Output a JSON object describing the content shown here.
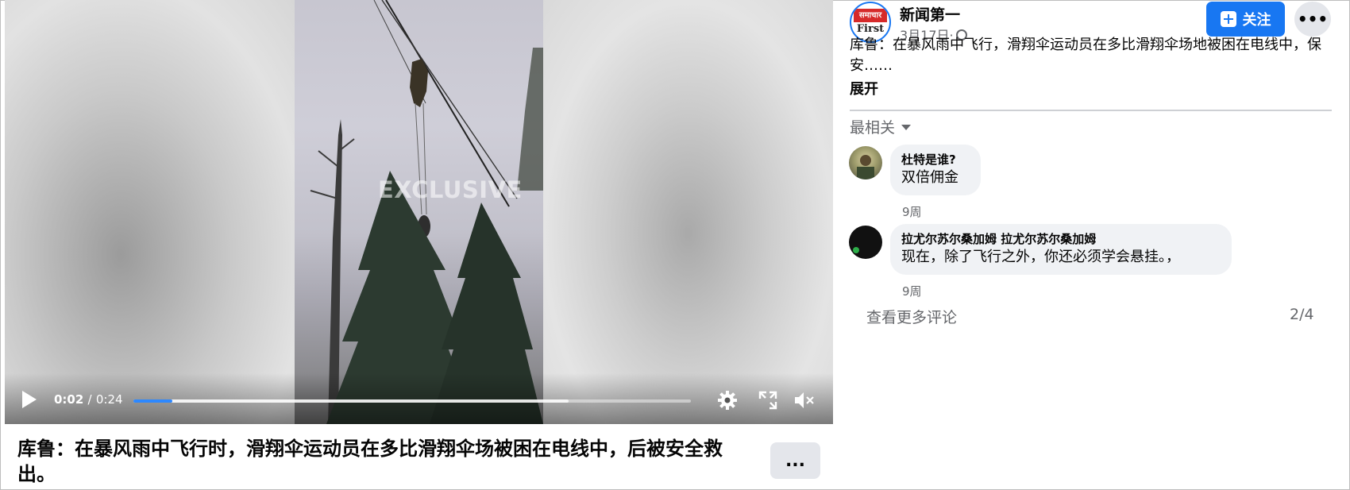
{
  "video": {
    "watermark": "EXCLUSIVE",
    "current_time": "0:02",
    "separator": "/",
    "duration": "0:24",
    "progress_fraction": 0.07,
    "buffered_fraction": 0.78,
    "accent": "#2d88ff",
    "icons": [
      "play-icon",
      "settings-gear-icon",
      "fullscreen-icon",
      "volume-muted-icon"
    ]
  },
  "caption": {
    "text": "库鲁：在暴风雨中飞行时，滑翔伞运动员在多比滑翔伞场被困在电线中，后被安全救出。",
    "more_label": "..."
  },
  "post": {
    "avatar_top": "समाचार",
    "avatar_bottom": "First",
    "page_name": "新闻第一",
    "date": "3月17日·",
    "follow_label": "关注",
    "more_label": "•••",
    "text": "库鲁：在暴风雨中飞行，滑翔伞运动员在多比滑翔伞场地被困在电线中，保安……",
    "expand_label": "展开",
    "brand_color": "#1877f2"
  },
  "comments": {
    "sort_label": "最相关",
    "items": [
      {
        "author": "杜特是谁?",
        "body": "双倍佣金",
        "time": "9周"
      },
      {
        "author": "拉尤尔苏尔桑加姆 拉尤尔苏尔桑加姆",
        "body": "现在，除了飞行之外，你还必须学会悬挂。，",
        "time": "9周"
      }
    ],
    "see_more_label": "查看更多评论",
    "pager": "2/4"
  }
}
